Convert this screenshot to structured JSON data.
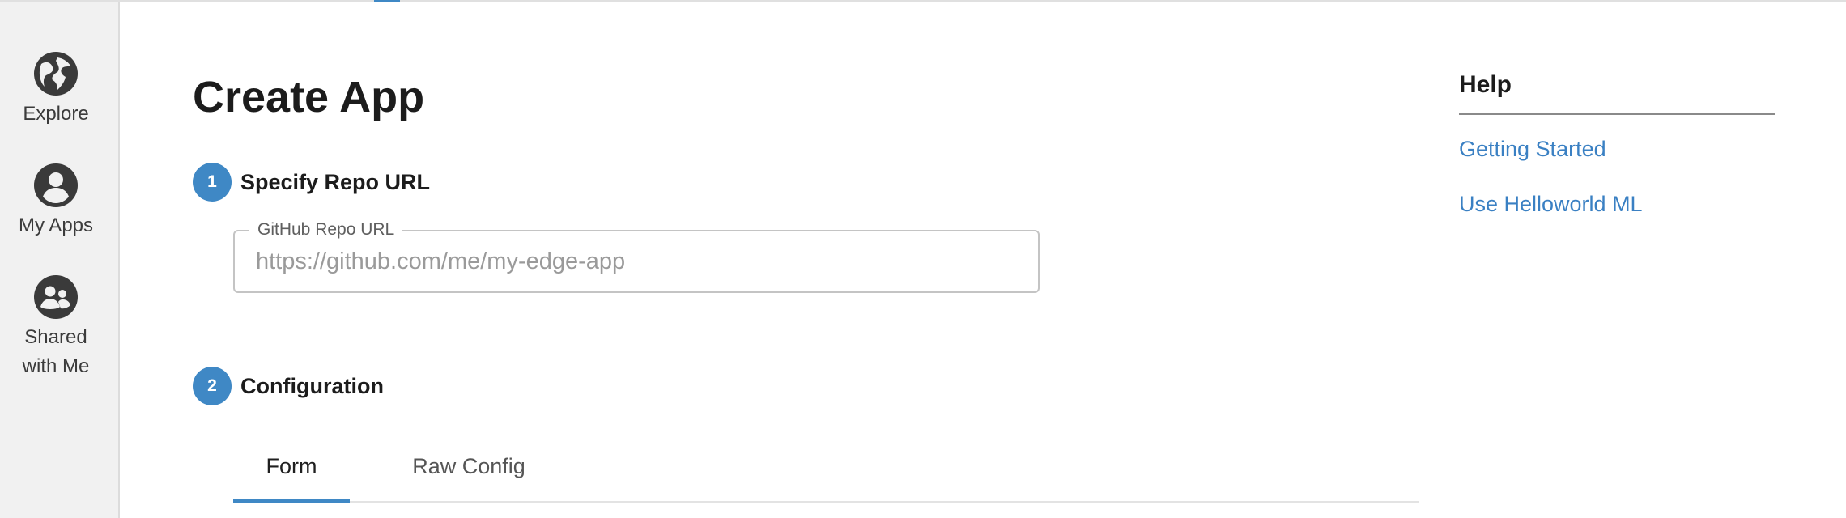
{
  "colors": {
    "accent": "#3f88c5",
    "link": "#3a80c3",
    "sidebar_bg": "#f1f1f1"
  },
  "sidebar": {
    "items": [
      {
        "label": "Explore",
        "icon": "globe-icon"
      },
      {
        "label": "My Apps",
        "icon": "user-icon"
      },
      {
        "label": "Shared\nwith Me",
        "icon": "shared-users-icon"
      }
    ]
  },
  "main": {
    "title": "Create App",
    "steps": [
      {
        "number": "1",
        "title": "Specify Repo URL"
      },
      {
        "number": "2",
        "title": "Configuration"
      }
    ],
    "repo_field": {
      "label": "GitHub Repo URL",
      "value": "",
      "placeholder": "https://github.com/me/my-edge-app"
    },
    "tabs": [
      {
        "label": "Form",
        "active": true
      },
      {
        "label": "Raw Config",
        "active": false
      }
    ]
  },
  "help": {
    "title": "Help",
    "links": [
      {
        "label": "Getting Started"
      },
      {
        "label": "Use Helloworld ML"
      }
    ]
  }
}
